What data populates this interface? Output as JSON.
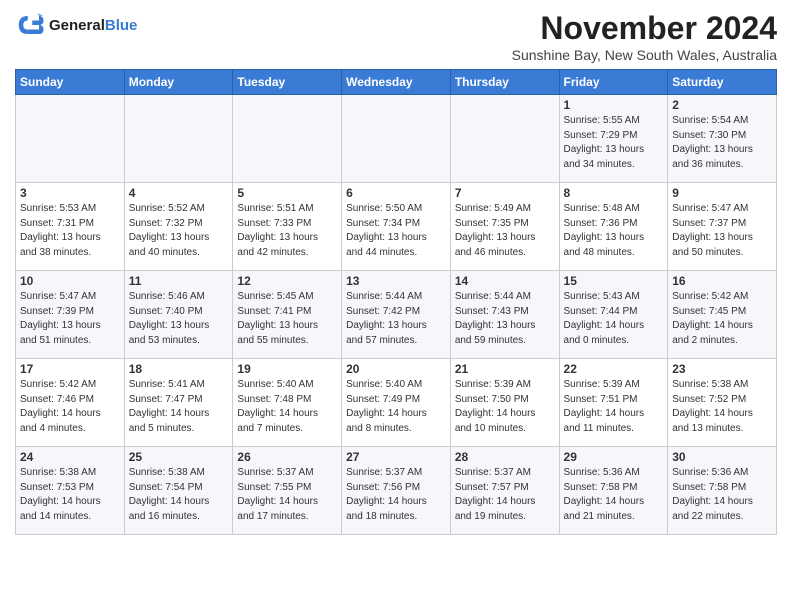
{
  "logo": {
    "line1": "General",
    "line2": "Blue"
  },
  "calendar": {
    "title": "November 2024",
    "subtitle": "Sunshine Bay, New South Wales, Australia",
    "days_of_week": [
      "Sunday",
      "Monday",
      "Tuesday",
      "Wednesday",
      "Thursday",
      "Friday",
      "Saturday"
    ],
    "weeks": [
      [
        {
          "day": "",
          "info": ""
        },
        {
          "day": "",
          "info": ""
        },
        {
          "day": "",
          "info": ""
        },
        {
          "day": "",
          "info": ""
        },
        {
          "day": "",
          "info": ""
        },
        {
          "day": "1",
          "info": "Sunrise: 5:55 AM\nSunset: 7:29 PM\nDaylight: 13 hours\nand 34 minutes."
        },
        {
          "day": "2",
          "info": "Sunrise: 5:54 AM\nSunset: 7:30 PM\nDaylight: 13 hours\nand 36 minutes."
        }
      ],
      [
        {
          "day": "3",
          "info": "Sunrise: 5:53 AM\nSunset: 7:31 PM\nDaylight: 13 hours\nand 38 minutes."
        },
        {
          "day": "4",
          "info": "Sunrise: 5:52 AM\nSunset: 7:32 PM\nDaylight: 13 hours\nand 40 minutes."
        },
        {
          "day": "5",
          "info": "Sunrise: 5:51 AM\nSunset: 7:33 PM\nDaylight: 13 hours\nand 42 minutes."
        },
        {
          "day": "6",
          "info": "Sunrise: 5:50 AM\nSunset: 7:34 PM\nDaylight: 13 hours\nand 44 minutes."
        },
        {
          "day": "7",
          "info": "Sunrise: 5:49 AM\nSunset: 7:35 PM\nDaylight: 13 hours\nand 46 minutes."
        },
        {
          "day": "8",
          "info": "Sunrise: 5:48 AM\nSunset: 7:36 PM\nDaylight: 13 hours\nand 48 minutes."
        },
        {
          "day": "9",
          "info": "Sunrise: 5:47 AM\nSunset: 7:37 PM\nDaylight: 13 hours\nand 50 minutes."
        }
      ],
      [
        {
          "day": "10",
          "info": "Sunrise: 5:47 AM\nSunset: 7:39 PM\nDaylight: 13 hours\nand 51 minutes."
        },
        {
          "day": "11",
          "info": "Sunrise: 5:46 AM\nSunset: 7:40 PM\nDaylight: 13 hours\nand 53 minutes."
        },
        {
          "day": "12",
          "info": "Sunrise: 5:45 AM\nSunset: 7:41 PM\nDaylight: 13 hours\nand 55 minutes."
        },
        {
          "day": "13",
          "info": "Sunrise: 5:44 AM\nSunset: 7:42 PM\nDaylight: 13 hours\nand 57 minutes."
        },
        {
          "day": "14",
          "info": "Sunrise: 5:44 AM\nSunset: 7:43 PM\nDaylight: 13 hours\nand 59 minutes."
        },
        {
          "day": "15",
          "info": "Sunrise: 5:43 AM\nSunset: 7:44 PM\nDaylight: 14 hours\nand 0 minutes."
        },
        {
          "day": "16",
          "info": "Sunrise: 5:42 AM\nSunset: 7:45 PM\nDaylight: 14 hours\nand 2 minutes."
        }
      ],
      [
        {
          "day": "17",
          "info": "Sunrise: 5:42 AM\nSunset: 7:46 PM\nDaylight: 14 hours\nand 4 minutes."
        },
        {
          "day": "18",
          "info": "Sunrise: 5:41 AM\nSunset: 7:47 PM\nDaylight: 14 hours\nand 5 minutes."
        },
        {
          "day": "19",
          "info": "Sunrise: 5:40 AM\nSunset: 7:48 PM\nDaylight: 14 hours\nand 7 minutes."
        },
        {
          "day": "20",
          "info": "Sunrise: 5:40 AM\nSunset: 7:49 PM\nDaylight: 14 hours\nand 8 minutes."
        },
        {
          "day": "21",
          "info": "Sunrise: 5:39 AM\nSunset: 7:50 PM\nDaylight: 14 hours\nand 10 minutes."
        },
        {
          "day": "22",
          "info": "Sunrise: 5:39 AM\nSunset: 7:51 PM\nDaylight: 14 hours\nand 11 minutes."
        },
        {
          "day": "23",
          "info": "Sunrise: 5:38 AM\nSunset: 7:52 PM\nDaylight: 14 hours\nand 13 minutes."
        }
      ],
      [
        {
          "day": "24",
          "info": "Sunrise: 5:38 AM\nSunset: 7:53 PM\nDaylight: 14 hours\nand 14 minutes."
        },
        {
          "day": "25",
          "info": "Sunrise: 5:38 AM\nSunset: 7:54 PM\nDaylight: 14 hours\nand 16 minutes."
        },
        {
          "day": "26",
          "info": "Sunrise: 5:37 AM\nSunset: 7:55 PM\nDaylight: 14 hours\nand 17 minutes."
        },
        {
          "day": "27",
          "info": "Sunrise: 5:37 AM\nSunset: 7:56 PM\nDaylight: 14 hours\nand 18 minutes."
        },
        {
          "day": "28",
          "info": "Sunrise: 5:37 AM\nSunset: 7:57 PM\nDaylight: 14 hours\nand 19 minutes."
        },
        {
          "day": "29",
          "info": "Sunrise: 5:36 AM\nSunset: 7:58 PM\nDaylight: 14 hours\nand 21 minutes."
        },
        {
          "day": "30",
          "info": "Sunrise: 5:36 AM\nSunset: 7:58 PM\nDaylight: 14 hours\nand 22 minutes."
        }
      ]
    ]
  }
}
